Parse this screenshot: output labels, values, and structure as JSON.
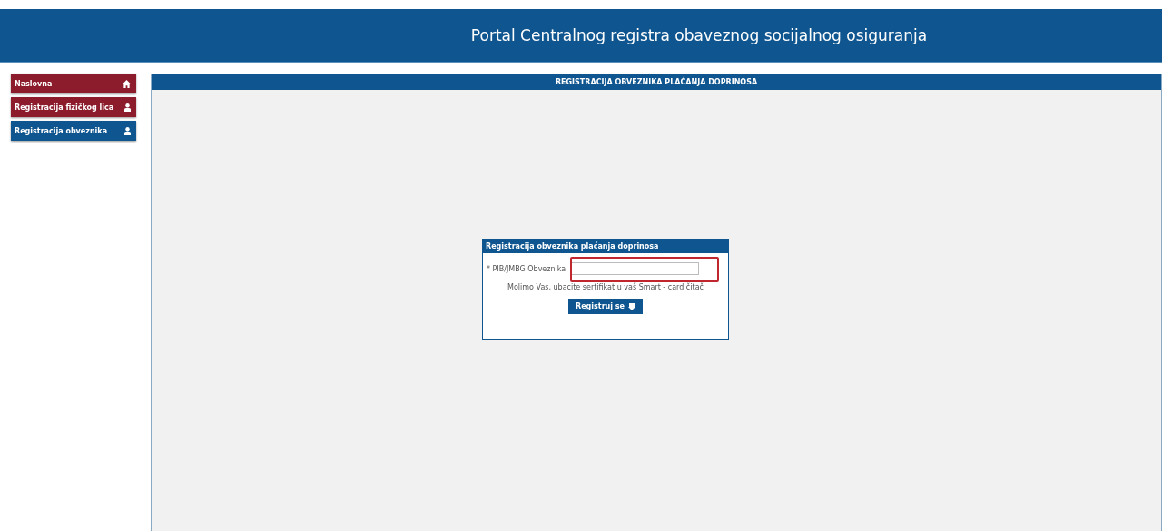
{
  "header": {
    "title": "Portal Centralnog registra obaveznog socijalnog osiguranja"
  },
  "sidebar": {
    "items": [
      {
        "label": "Naslovna",
        "kind": "home",
        "selected": false
      },
      {
        "label": "Registracija fizičkog lica",
        "kind": "person",
        "selected": false
      },
      {
        "label": "Registracija obveznika",
        "kind": "person",
        "selected": true
      }
    ]
  },
  "panel": {
    "title": "REGISTRACIJA OBVEZNIKA PLAĆANJA DOPRINOSA",
    "form": {
      "title": "Registracija obveznika plaćanja doprinosa",
      "field_label": "* PIB/JMBG Obveznika",
      "highlighted": true,
      "message": "Molimo Vas, ubacite sertifikat u vaš Smart - card čitač",
      "button": "Registruj se"
    }
  }
}
